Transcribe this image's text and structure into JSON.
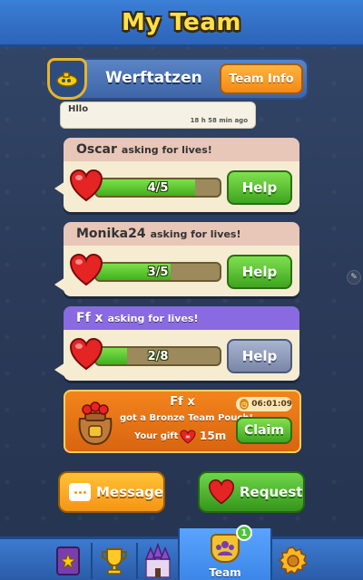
{
  "header": {
    "title": "My Team"
  },
  "team": {
    "name": "Werftatzen",
    "info_button": "Team Info",
    "badge_icon": "submarine-icon"
  },
  "chat": {
    "message": "Hllo",
    "time": "18 h 58 min ago"
  },
  "requests": [
    {
      "name": "Oscar",
      "label": "asking for lives!",
      "lives_text": "4/5",
      "lives_fraction": 0.8,
      "button": "Help",
      "button_style": "green",
      "head_style": "pink"
    },
    {
      "name": "Monika24",
      "label": "asking for lives!",
      "lives_text": "3/5",
      "lives_fraction": 0.6,
      "button": "Help",
      "button_style": "green",
      "head_style": "pink"
    },
    {
      "name": "Ff x",
      "label": "asking for lives!",
      "lives_text": "2/8",
      "lives_fraction": 0.25,
      "button": "Help",
      "button_style": "grey",
      "head_style": "purple"
    }
  ],
  "gift": {
    "name": "Ff x",
    "description": "got a Bronze Team Pouch!",
    "your_gift_label": "Your gift",
    "amount": "15m",
    "timer": "06:01:09",
    "claim_button": "Claim"
  },
  "actions": {
    "message_button": "Message",
    "request_button": "Request"
  },
  "nav": {
    "items": [
      "profile-card-icon",
      "trophy-icon",
      "castle-icon",
      "team-icon",
      "gear-icon"
    ],
    "team_label": "Team",
    "team_badge_count": "1"
  },
  "colors": {
    "accent_green": "#3fa41f",
    "accent_orange": "#f28a14",
    "header_blue": "#2c64b8",
    "title_yellow": "#ffe04a"
  }
}
